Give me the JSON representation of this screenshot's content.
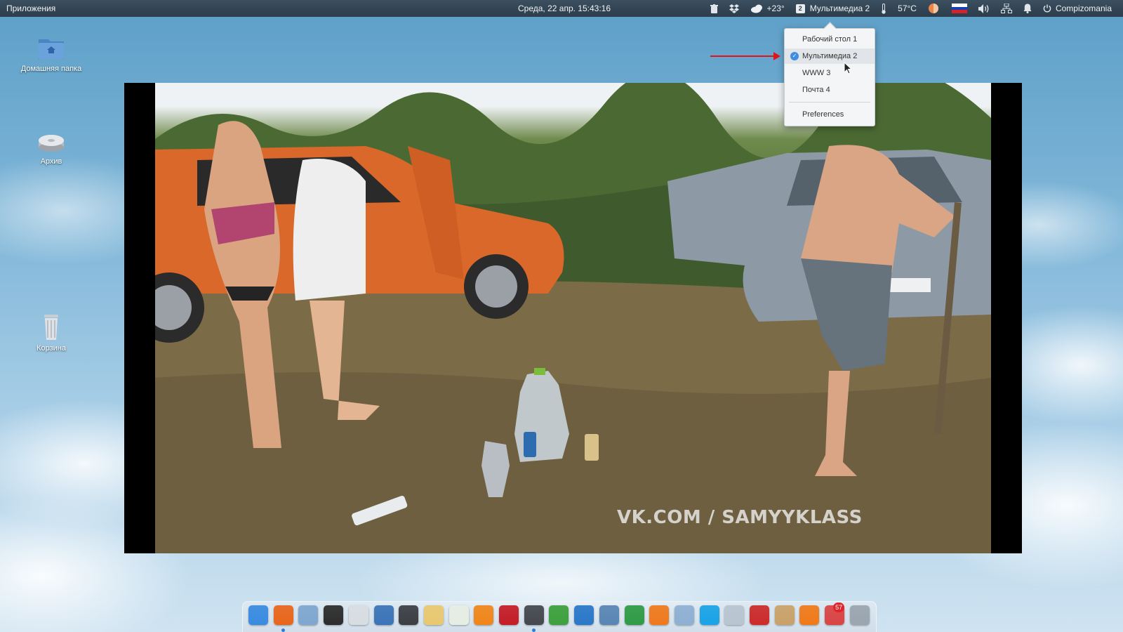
{
  "panel": {
    "apps_menu": "Приложения",
    "clock": "Среда, 22 апр. 15:43:16",
    "weather_temp": "+23°",
    "workspace_number": "2",
    "workspace_name": "Мультимедиа 2",
    "cpu_temp": "57°C",
    "user_name": "Compizomania",
    "icons": [
      "trash-icon",
      "dropbox-icon",
      "weather-icon",
      "workspace-icon",
      "thermometer-icon",
      "redshift-icon",
      "flag-icon",
      "volume-icon",
      "network-icon",
      "notification-bell-icon",
      "power-icon"
    ]
  },
  "desktop": {
    "icons": [
      {
        "label": "Домашняя папка",
        "icon": "home-folder-icon"
      },
      {
        "label": "Архив",
        "icon": "drive-icon"
      },
      {
        "label": "Корзина",
        "icon": "trash-bin-icon"
      }
    ]
  },
  "workspace_menu": {
    "items": [
      {
        "label": "Рабочий стол 1",
        "active": false
      },
      {
        "label": "Мультимедиа 2",
        "active": true
      },
      {
        "label": "WWW 3",
        "active": false
      },
      {
        "label": "Почта 4",
        "active": false
      }
    ],
    "preferences": "Preferences"
  },
  "video": {
    "watermark": "VK.COM / SAMYYKLASS"
  },
  "dock": {
    "items": [
      {
        "icon": "workspace-switcher-icon",
        "color": "#3a8be0"
      },
      {
        "icon": "firefox-icon",
        "color": "#e8661c",
        "running": true
      },
      {
        "icon": "files-icon",
        "color": "#7fa7cf"
      },
      {
        "icon": "terminal-icon",
        "color": "#2d2d2d"
      },
      {
        "icon": "text-editor-icon",
        "color": "#d8dde2"
      },
      {
        "icon": "shotwell-icon",
        "color": "#3b74b8"
      },
      {
        "icon": "system-monitor-icon",
        "color": "#3c3f44"
      },
      {
        "icon": "mail-icon",
        "color": "#e9c870"
      },
      {
        "icon": "spreadsheet-icon",
        "color": "#e6ede3"
      },
      {
        "icon": "music-icon",
        "color": "#f0861b"
      },
      {
        "icon": "video-player-icon",
        "color": "#c41e27"
      },
      {
        "icon": "screenshot-icon",
        "color": "#45494f",
        "running": true
      },
      {
        "icon": "media-play-icon",
        "color": "#3da03d"
      },
      {
        "icon": "tv-icon",
        "color": "#2a78c8"
      },
      {
        "icon": "image-viewer-icon",
        "color": "#5a86b4"
      },
      {
        "icon": "sync-icon",
        "color": "#2f9b47"
      },
      {
        "icon": "app-store-icon",
        "color": "#ef7a1e"
      },
      {
        "icon": "toggle-settings-icon",
        "color": "#8fb0d3"
      },
      {
        "icon": "skype-icon",
        "color": "#1aa3e6"
      },
      {
        "icon": "home-folder-icon",
        "color": "#b8c4cf"
      },
      {
        "icon": "search-tool-icon",
        "color": "#cc2b2b"
      },
      {
        "icon": "folder-info-icon",
        "color": "#c9a26a"
      },
      {
        "icon": "update-icon",
        "color": "#f07a1a"
      },
      {
        "icon": "calendar-icon",
        "color": "#d94545",
        "badge": "57"
      },
      {
        "icon": "notes-icon",
        "color": "#9aa5b0"
      }
    ]
  }
}
